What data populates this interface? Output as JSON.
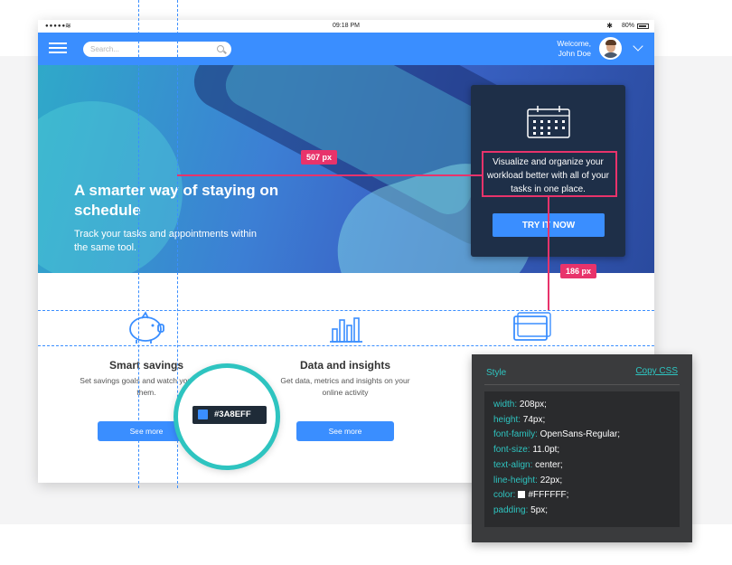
{
  "statusbar": {
    "time": "09:18 PM",
    "battery": "80%",
    "signal_dots": "●●●●●"
  },
  "appbar": {
    "search_placeholder": "Search...",
    "welcome_line1": "Welcome,",
    "welcome_line2": "John Doe"
  },
  "hero": {
    "title": "A smarter way of staying on schedule",
    "subtitle": "Track your tasks and appointments within the same tool."
  },
  "card": {
    "text": "Visualize and organize your workload better with all of your tasks in one  place.",
    "button_label": "TRY IT NOW"
  },
  "features": [
    {
      "title": "Smart savings",
      "text": "Set savings goals and watch you reach them.",
      "button_label": "See more",
      "icon": "piggy-bank-icon"
    },
    {
      "title": "Data and insights",
      "text": "Get data, metrics and insights on your online activity",
      "button_label": "See more",
      "icon": "bar-chart-icon"
    },
    {
      "title": "",
      "text": "",
      "button_label": "",
      "icon": "cards-icon"
    }
  ],
  "measurements": {
    "horizontal": "507 px",
    "vertical": "186 px"
  },
  "color_picker": {
    "hex": "#3A8EFF",
    "color": "#3a8eff"
  },
  "style_panel": {
    "title": "Style",
    "copy_label": "Copy CSS",
    "properties": [
      {
        "prop": "width:",
        "value": " 208px;"
      },
      {
        "prop": "height:",
        "value": " 74px;"
      },
      {
        "prop": "font-family:",
        "value": " OpenSans-Regular;"
      },
      {
        "prop": "font-size:",
        "value": " 11.0pt;"
      },
      {
        "prop": "text-align:",
        "value": " center;"
      },
      {
        "prop": "line-height:",
        "value": " 22px;"
      },
      {
        "prop": "color:",
        "value": "#FFFFFF;"
      },
      {
        "prop": "padding:",
        "value": " 5px;"
      }
    ]
  },
  "colors": {
    "brand": "#3a8eff",
    "accent_measure": "#e8336b",
    "accent_teal": "#2ec4c0",
    "card": "#1e2f48"
  }
}
